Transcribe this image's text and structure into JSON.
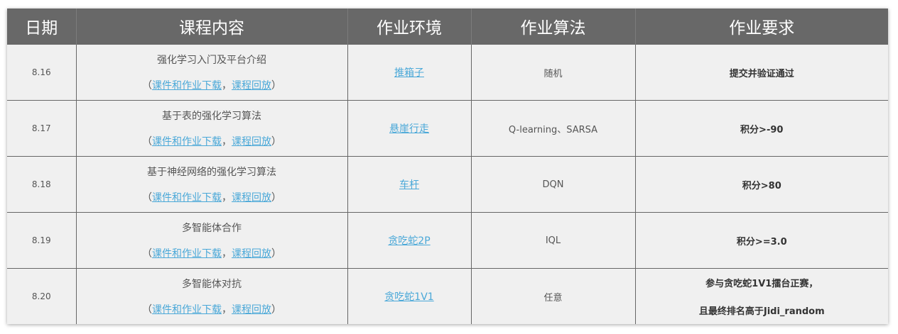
{
  "headers": [
    "日期",
    "课程内容",
    "作业环境",
    "作业算法",
    "作业要求"
  ],
  "link_labels": {
    "open": "（",
    "slides": "课件和作业下载",
    "sep": "，",
    "replay": "课程回放",
    "close": "）"
  },
  "rows": [
    {
      "date": "8.16",
      "topic": "强化学习入门及平台介绍",
      "env": "推箱子",
      "algo": "随机",
      "req": [
        "提交并验证通过"
      ]
    },
    {
      "date": "8.17",
      "topic": "基于表的强化学习算法",
      "env": "悬崖行走",
      "algo": "Q-learning、SARSA",
      "req": [
        "积分>-90"
      ]
    },
    {
      "date": "8.18",
      "topic": "基于神经网络的强化学习算法",
      "env": "车杆",
      "algo": "DQN",
      "req": [
        "积分>80"
      ]
    },
    {
      "date": "8.19",
      "topic": "多智能体合作",
      "env": "贪吃蛇2P",
      "algo": "IQL",
      "req": [
        "积分>=3.0"
      ]
    },
    {
      "date": "8.20",
      "topic": "多智能体对抗",
      "env": "贪吃蛇1V1",
      "algo": "任意",
      "req": [
        "参与贪吃蛇1V1擂台正赛，",
        "且最终排名高于Jidi_random"
      ]
    }
  ],
  "colors": {
    "header_bg": "#686868",
    "cell_bg": "#f0f0f0",
    "link": "#4aa8d8",
    "border": "#666666"
  }
}
